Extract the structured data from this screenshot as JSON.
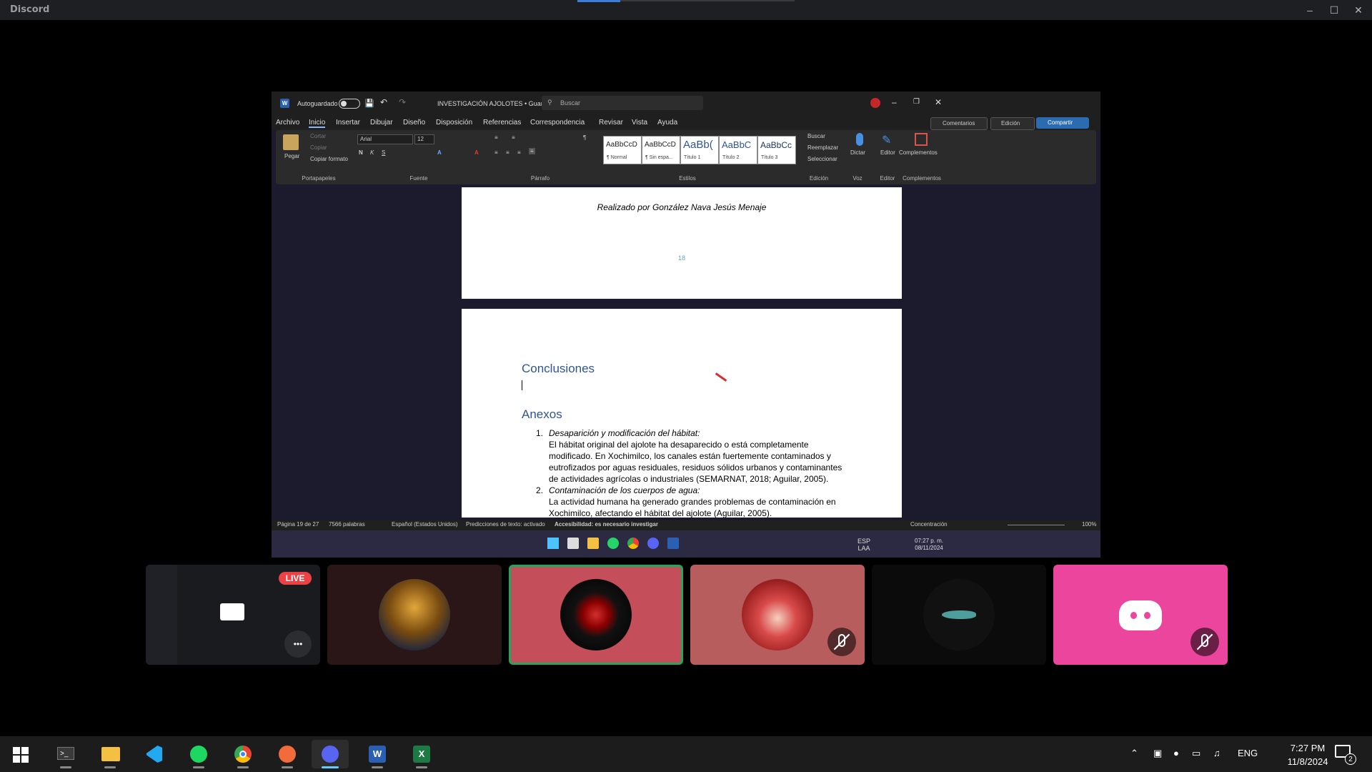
{
  "discord": {
    "app_title": "Discord"
  },
  "word": {
    "autosave_label": "Autoguardado",
    "doc_title": "INVESTIGACIÓN AJOLOTES • Guardado",
    "search_placeholder": "Buscar",
    "tabs": [
      "Archivo",
      "Inicio",
      "Insertar",
      "Dibujar",
      "Diseño",
      "Disposición",
      "Referencias",
      "Correspondencia",
      "Revisar",
      "Vista",
      "Ayuda"
    ],
    "comments_label": "Comentarios",
    "edit_label": "Edición",
    "share_label": "Compartir",
    "clipboard": {
      "paste": "Pegar",
      "cut": "Cortar",
      "copy": "Copiar",
      "format_painter": "Copiar formato",
      "group": "Portapapeles"
    },
    "font": {
      "name": "Arial",
      "size": "12",
      "group": "Fuente"
    },
    "paragraph_group": "Párrafo",
    "styles": [
      {
        "preview": "AaBbCcD",
        "name": "¶ Normal"
      },
      {
        "preview": "AaBbCcD",
        "name": "¶ Sin espa..."
      },
      {
        "preview": "AaBb(",
        "name": "Título 1"
      },
      {
        "preview": "AaBbC",
        "name": "Título 2"
      },
      {
        "preview": "AaBbCc",
        "name": "Título 3"
      }
    ],
    "styles_group": "Estilos",
    "editing": {
      "find": "Buscar",
      "replace": "Reemplazar",
      "select": "Seleccionar",
      "group": "Edición"
    },
    "voice": {
      "dictate": "Dictar",
      "group": "Voz"
    },
    "editor": {
      "label": "Editor",
      "group": "Editor"
    },
    "addins": {
      "label": "Complementos",
      "group": "Complementos"
    },
    "document": {
      "author_line": "Realizado por González Nava Jesús Menaje",
      "page_number": "18",
      "heading_conclusions": "Conclusiones",
      "heading_annexes": "Anexos",
      "items": [
        {
          "num": "1.",
          "title": "Desaparición y modificación del hábitat:",
          "lines": [
            "El hábitat original del ajolote ha desaparecido o está completamente",
            "modificado. En Xochimilco, los canales están fuertemente contaminados y",
            "eutrofizados por aguas residuales, residuos sólidos urbanos y contaminantes",
            "de actividades agrícolas o industriales (SEMARNAT, 2018; Aguilar, 2005)."
          ]
        },
        {
          "num": "2.",
          "title": "Contaminación de los cuerpos de agua:",
          "lines": [
            "La actividad humana ha generado grandes problemas de contaminación en",
            "Xochimilco, afectando el hábitat del ajolote (Aguilar, 2005)."
          ]
        }
      ]
    },
    "status": {
      "page": "Página 19 de 27",
      "words": "7566 palabras",
      "language": "Español (Estados Unidos)",
      "predictions": "Predicciones de texto: activado",
      "accessibility": "Accesibilidad: es necesario investigar",
      "focus": "Concentración",
      "zoom": "100%"
    }
  },
  "inner_taskbar": {
    "lang_top": "ESP",
    "lang_bottom": "LAA",
    "time": "07:27 p. m.",
    "date": "08/11/2024"
  },
  "participants": {
    "live_badge": "LIVE",
    "more_label": "•••"
  },
  "taskbar": {
    "apps": [
      "terminal-icon",
      "file-explorer-icon",
      "vscode-icon",
      "spotify-icon",
      "chrome-icon",
      "paint-icon",
      "discord-icon",
      "word-icon",
      "excel-icon"
    ],
    "lang": "ENG",
    "time": "7:27 PM",
    "date": "11/8/2024",
    "notification_count": "2"
  },
  "colors": {
    "word_blue": "#2f5496",
    "discord_pink": "#eb459e",
    "speaking_green": "#23a55a",
    "live_red": "#ed4245"
  }
}
